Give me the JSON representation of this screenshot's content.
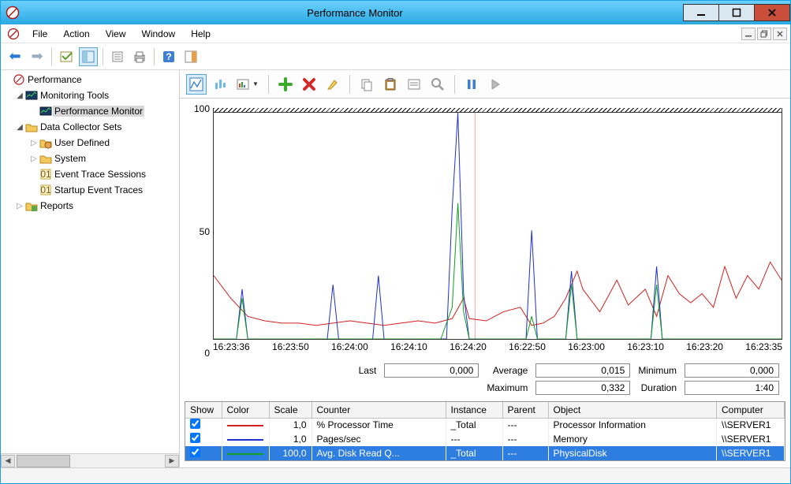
{
  "title": "Performance Monitor",
  "menu": {
    "file": "File",
    "action": "Action",
    "view": "View",
    "window": "Window",
    "help": "Help"
  },
  "tree": {
    "root": "Performance",
    "monitoring_tools": "Monitoring Tools",
    "perfmon": "Performance Monitor",
    "dcs": "Data Collector Sets",
    "user_defined": "User Defined",
    "system": "System",
    "ets": "Event Trace Sessions",
    "set": "Startup Event Traces",
    "reports": "Reports"
  },
  "stats": {
    "last_label": "Last",
    "last": "0,000",
    "avg_label": "Average",
    "avg": "0,015",
    "min_label": "Minimum",
    "min": "0,000",
    "max_label": "Maximum",
    "max": "0,332",
    "dur_label": "Duration",
    "dur": "1:40"
  },
  "legend": {
    "cols": {
      "show": "Show",
      "color": "Color",
      "scale": "Scale",
      "counter": "Counter",
      "instance": "Instance",
      "parent": "Parent",
      "object": "Object",
      "computer": "Computer"
    },
    "rows": [
      {
        "checked": true,
        "color": "#d12020",
        "scale": "1,0",
        "counter": "% Processor Time",
        "instance": "_Total",
        "parent": "---",
        "object": "Processor Information",
        "computer": "\\\\SERVER1",
        "selected": false
      },
      {
        "checked": true,
        "color": "#2030d0",
        "scale": "1,0",
        "counter": "Pages/sec",
        "instance": "---",
        "parent": "---",
        "object": "Memory",
        "computer": "\\\\SERVER1",
        "selected": false
      },
      {
        "checked": true,
        "color": "#10a020",
        "scale": "100,0",
        "counter": "Avg. Disk Read Q...",
        "instance": "_Total",
        "parent": "---",
        "object": "PhysicalDisk",
        "computer": "\\\\SERVER1",
        "selected": true
      }
    ]
  },
  "chart_data": {
    "type": "line",
    "ylim": [
      0,
      100
    ],
    "yticks": [
      0,
      50,
      100
    ],
    "xticks": [
      "16:23:36",
      "16:23:50",
      "16:24:00",
      "16:24:10",
      "16:24:20",
      "16:22:50",
      "16:23:00",
      "16:23:10",
      "16:23:20",
      "16:23:35"
    ],
    "time_bar_x": 46,
    "series": [
      {
        "name": "% Processor Time",
        "color": "#d12020",
        "values": [
          [
            0,
            28
          ],
          [
            3,
            18
          ],
          [
            6,
            10
          ],
          [
            9,
            8
          ],
          [
            12,
            7
          ],
          [
            15,
            7
          ],
          [
            18,
            6
          ],
          [
            21,
            7
          ],
          [
            24,
            8
          ],
          [
            27,
            7
          ],
          [
            30,
            6
          ],
          [
            33,
            7
          ],
          [
            36,
            8
          ],
          [
            39,
            7
          ],
          [
            42,
            9
          ],
          [
            44,
            18
          ],
          [
            45,
            9
          ],
          [
            48,
            8
          ],
          [
            51,
            12
          ],
          [
            54,
            14
          ],
          [
            56,
            6
          ],
          [
            58,
            7
          ],
          [
            60,
            10
          ],
          [
            62,
            18
          ],
          [
            64,
            30
          ],
          [
            65,
            22
          ],
          [
            68,
            12
          ],
          [
            71,
            26
          ],
          [
            73,
            15
          ],
          [
            76,
            22
          ],
          [
            78,
            10
          ],
          [
            80,
            28
          ],
          [
            82,
            20
          ],
          [
            84,
            16
          ],
          [
            86,
            20
          ],
          [
            88,
            14
          ],
          [
            90,
            32
          ],
          [
            92,
            18
          ],
          [
            94,
            28
          ],
          [
            96,
            22
          ],
          [
            98,
            34
          ],
          [
            100,
            26
          ]
        ]
      },
      {
        "name": "Pages/sec",
        "color": "#2030d0",
        "values": [
          [
            0,
            0
          ],
          [
            4,
            0
          ],
          [
            5,
            22
          ],
          [
            6,
            0
          ],
          [
            20,
            0
          ],
          [
            21,
            24
          ],
          [
            22,
            0
          ],
          [
            28,
            0
          ],
          [
            29,
            28
          ],
          [
            30,
            0
          ],
          [
            41,
            0
          ],
          [
            42,
            58
          ],
          [
            43,
            100
          ],
          [
            44,
            20
          ],
          [
            45,
            0
          ],
          [
            55,
            0
          ],
          [
            56,
            48
          ],
          [
            57,
            0
          ],
          [
            62,
            0
          ],
          [
            63,
            30
          ],
          [
            64,
            0
          ],
          [
            77,
            0
          ],
          [
            78,
            32
          ],
          [
            79,
            0
          ],
          [
            100,
            0
          ]
        ]
      },
      {
        "name": "Avg. Disk Read Queue Length",
        "color": "#10a020",
        "values": [
          [
            0,
            0
          ],
          [
            4,
            0
          ],
          [
            5,
            18
          ],
          [
            6,
            0
          ],
          [
            40,
            0
          ],
          [
            42,
            14
          ],
          [
            43,
            60
          ],
          [
            44,
            12
          ],
          [
            45,
            0
          ],
          [
            55,
            0
          ],
          [
            56,
            10
          ],
          [
            57,
            0
          ],
          [
            62,
            0
          ],
          [
            63,
            24
          ],
          [
            64,
            0
          ],
          [
            77,
            0
          ],
          [
            78,
            24
          ],
          [
            79,
            0
          ],
          [
            100,
            0
          ]
        ]
      }
    ]
  }
}
